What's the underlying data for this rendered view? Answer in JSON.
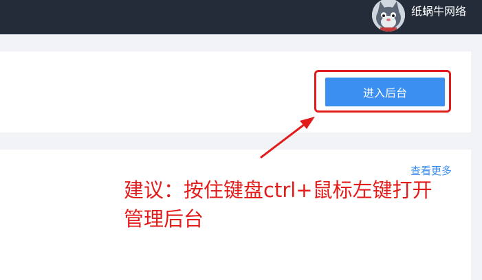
{
  "header": {
    "username": "纸蜗牛网络",
    "avatar_icon": "cat-avatar-icon",
    "bg_color": "#232c38"
  },
  "main": {
    "enter_admin_label": "进入后台",
    "view_more_label": "查看更多",
    "accent_color": "#3b8ff1"
  },
  "annotation": {
    "line1": "建议：按住键盘ctrl+鼠标左键打开",
    "line2": "管理后台",
    "color": "#e21b1b",
    "arrow_icon": "arrow-icon"
  }
}
